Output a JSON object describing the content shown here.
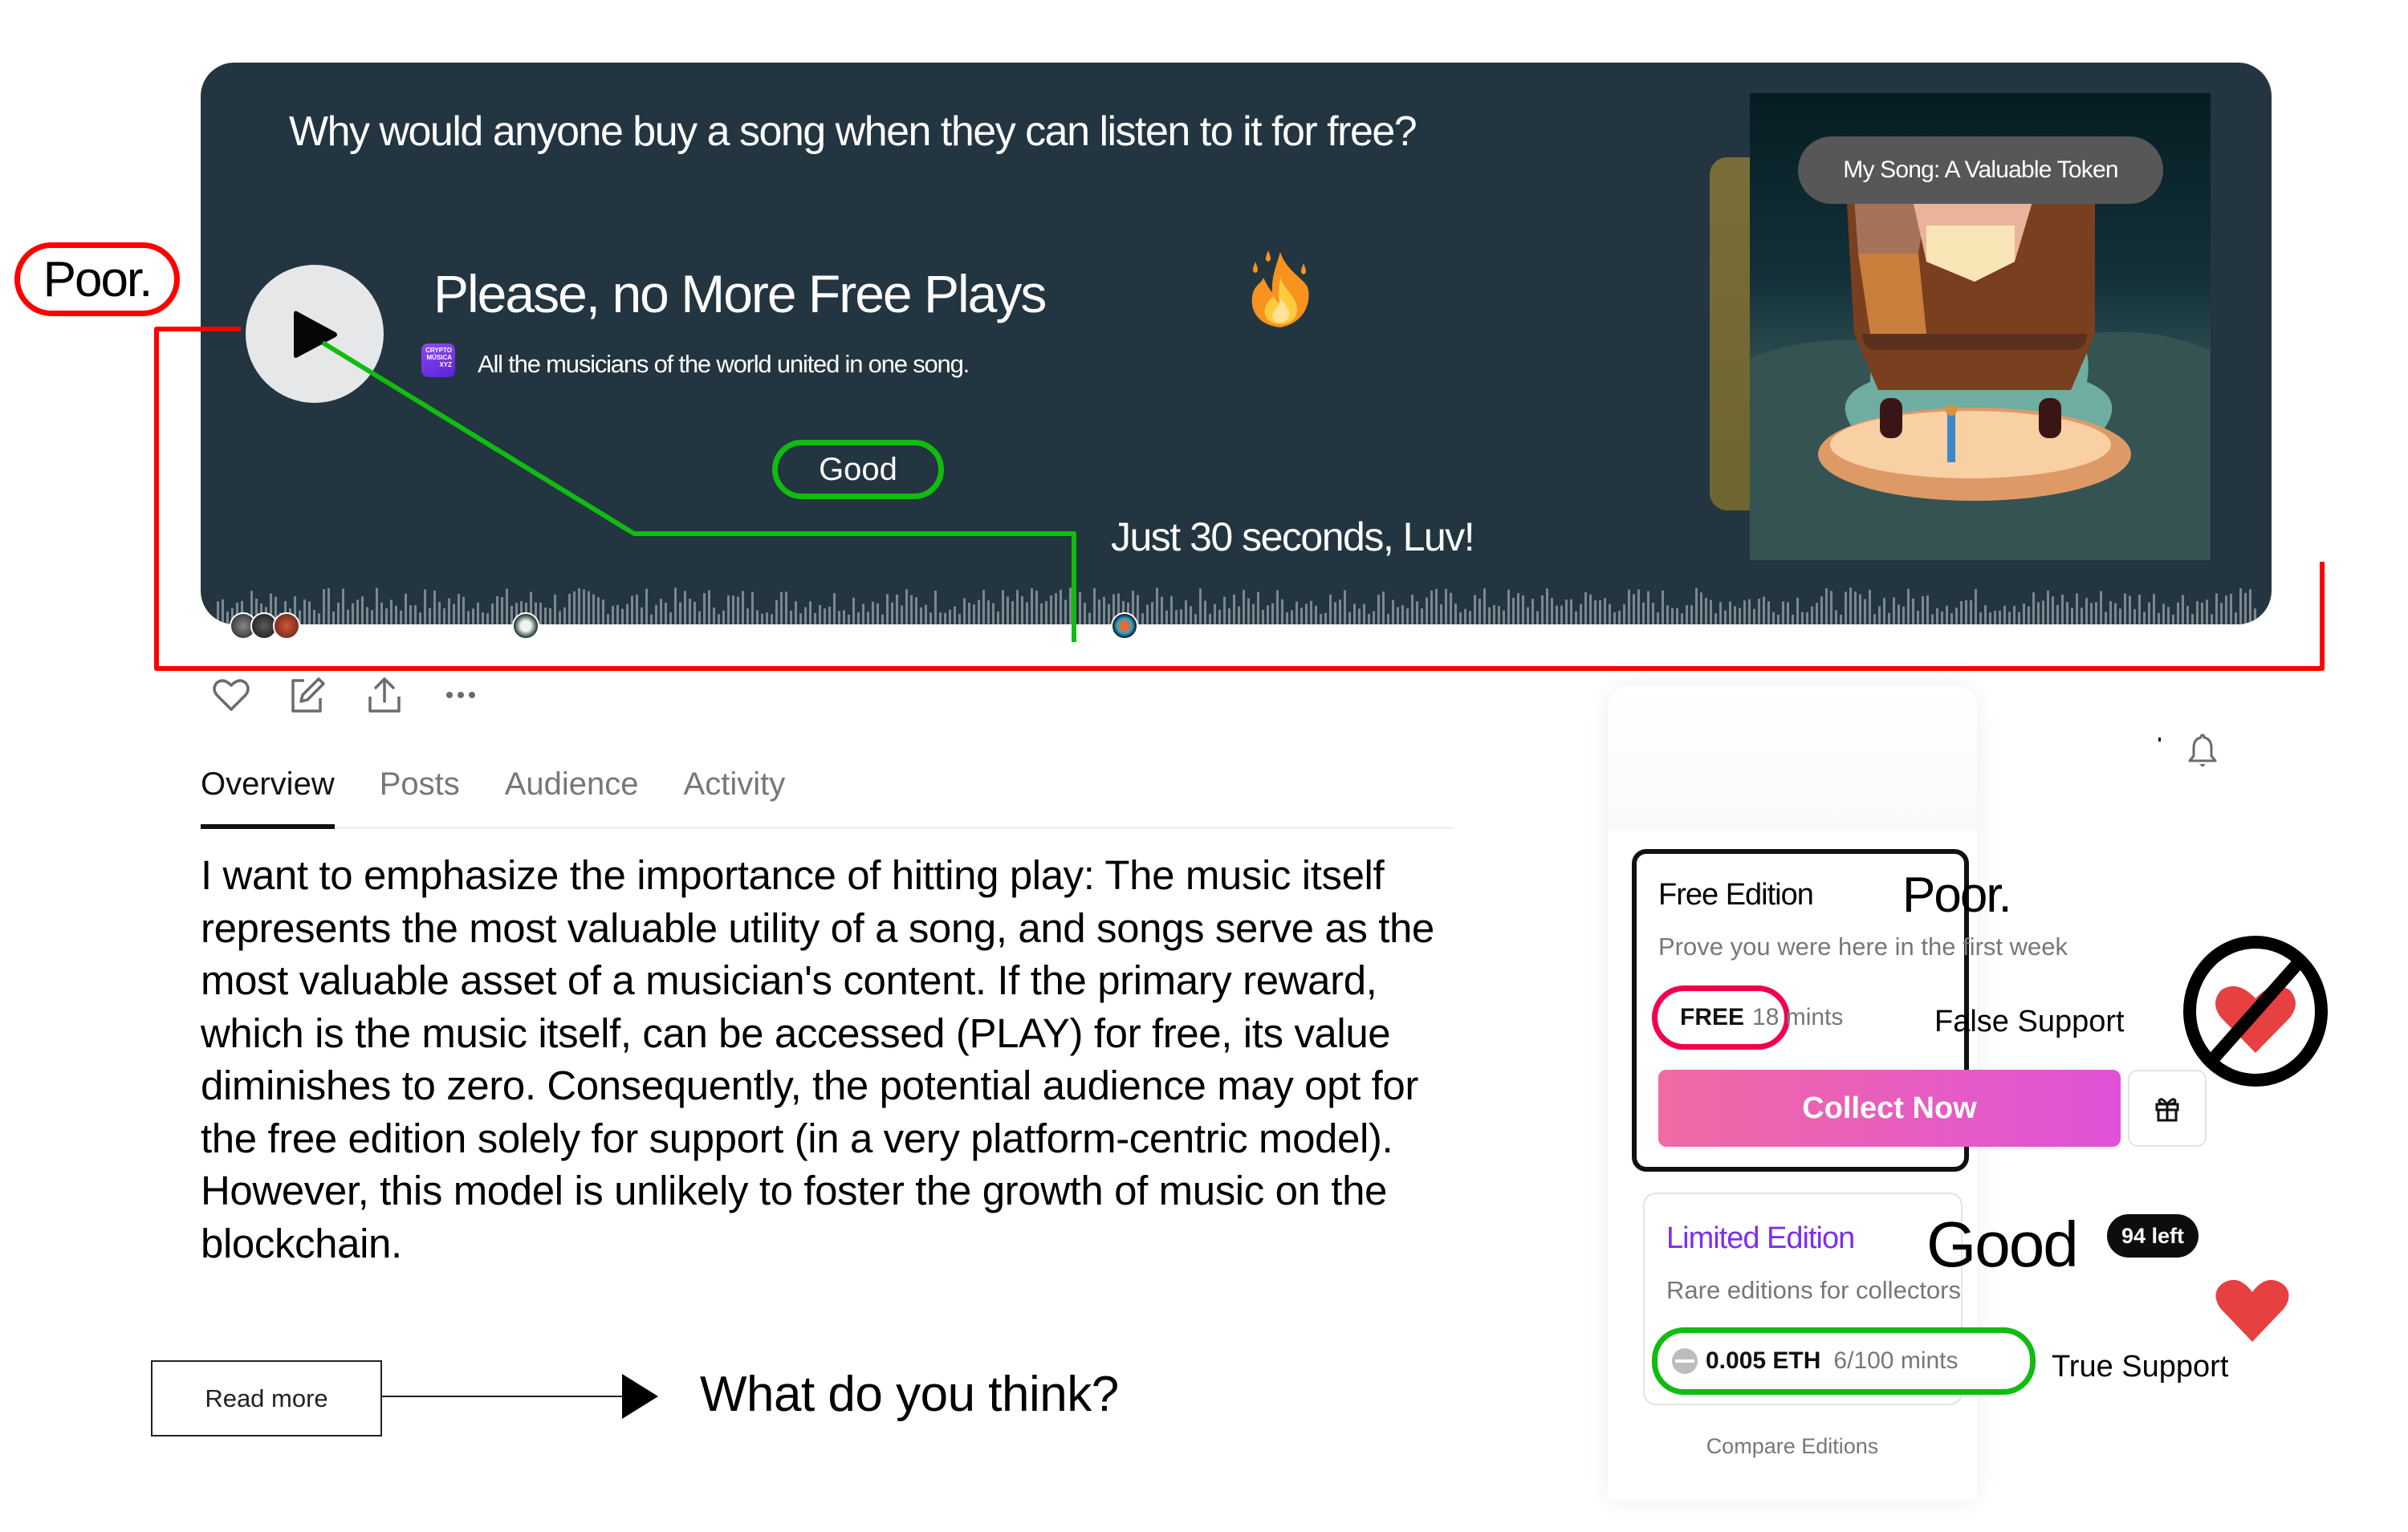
{
  "hero": {
    "question": "Why would anyone buy a song when they can listen to it for free?",
    "song_title": "Please, no More Free Plays",
    "song_subtitle": "All the musicians of the world united in one song.",
    "project_logo_text": "CRYPTO MÚSICA XYZ",
    "good_label": "Good",
    "preview_note": "Just 30 seconds, Luv!",
    "artwork_label": "My Song: A Valuable Token",
    "play_icon": "play-icon",
    "fire_icon": "fire-emoji"
  },
  "annotations": {
    "poor_left": "Poor.",
    "line_colors": {
      "poor": "#ff0000",
      "good": "#10bc10"
    }
  },
  "actions": [
    {
      "icon": "heart-icon"
    },
    {
      "icon": "edit-icon"
    },
    {
      "icon": "share-icon"
    },
    {
      "icon": "more-icon"
    }
  ],
  "tabs": [
    {
      "label": "Overview",
      "active": true
    },
    {
      "label": "Posts",
      "active": false
    },
    {
      "label": "Audience",
      "active": false
    },
    {
      "label": "Activity",
      "active": false
    }
  ],
  "body_text": "I want to emphasize the importance of hitting play: The music itself represents the most valuable utility of a song, and songs serve as the most valuable asset of a musician's content. If the primary reward, which is the music itself, can be accessed (PLAY) for free, its value diminishes to zero. Consequently, the potential audience may opt for the free edition solely for support (in a very platform-centric model). However, this model is unlikely to foster the growth of music on the blockchain.",
  "read_more_label": "Read more",
  "what_think": "What do you think?",
  "sidebar": {
    "bell_icon": "bell-icon",
    "free_edition": {
      "title": "Free Edition",
      "rating": "Poor.",
      "description": "Prove you were here in the first week",
      "price": "FREE",
      "mints": "18 mints",
      "support_label": "False Support",
      "collect_label": "Collect Now",
      "gift_icon": "gift-icon",
      "pill_border_color": "#f2004b"
    },
    "limited_edition": {
      "title": "Limited Edition",
      "rating": "Good",
      "remaining_badge": "94 left",
      "description": "Rare editions for collectors",
      "price": "0.005 ETH",
      "mints": "6/100 mints",
      "support_label": "True Support",
      "title_color": "#7b2ff0",
      "pill_border_color": "#10bc10"
    },
    "compare_label": "Compare Editions"
  },
  "colors": {
    "hero_bg": "#233540",
    "heart_red": "#e64040",
    "collect_gradient": [
      "#f06aa2",
      "#df52d8"
    ]
  }
}
